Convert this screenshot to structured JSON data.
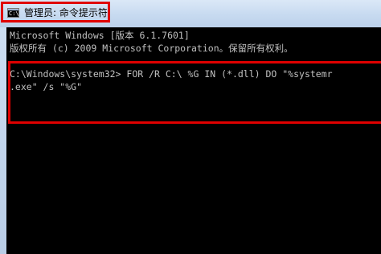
{
  "window": {
    "title": "管理员: 命令提示符",
    "icon": "cmd-icon",
    "icon_glyph": "C:\\"
  },
  "console": {
    "lines": [
      "Microsoft Windows [版本 6.1.7601]",
      "版权所有 (c) 2009 Microsoft Corporation。保留所有权利。",
      "",
      "C:\\Windows\\system32> FOR /R C:\\ %G IN (*.dll) DO \"%systemr",
      ".exe\" /s \"%G\""
    ]
  },
  "colors": {
    "console_background": "#000000",
    "console_text": "#c0c0c0",
    "highlight_border": "#e00000"
  }
}
